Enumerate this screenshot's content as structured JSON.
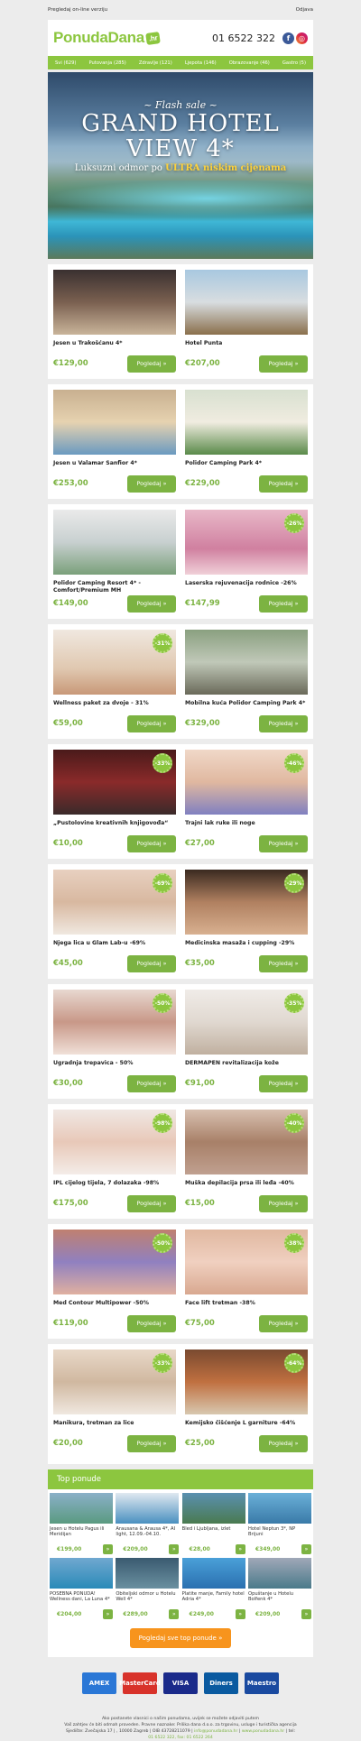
{
  "topbar": {
    "online": "Pregledaj on-line verziju",
    "unsubscribe": "Odjava"
  },
  "header": {
    "logo": "PonudaDana",
    "logo_hr": ".hr",
    "phone": "01 6522 322",
    "fb": "f",
    "ig": "◎"
  },
  "nav": [
    "Svi (629)",
    "Putovanja (285)",
    "Zdravlje (121)",
    "Ljepota (146)",
    "Obrazovanje (46)",
    "Gastro (5)"
  ],
  "hero": {
    "flash": "~ Flash sale ~",
    "title1": "GRAND HOTEL",
    "title2": "VIEW 4*",
    "sub_a": "Luksuzni odmor po ",
    "sub_b": "ULTRA niskim cijenama"
  },
  "cards": [
    {
      "title": "Jesen u Trakošćanu 4*",
      "price": "€129,00",
      "button": "Pogledaj »",
      "bg": "linear-gradient(180deg,#3a3030,#7a6050 50%,#c9b49a)"
    },
    {
      "title": "Hotel Punta",
      "price": "€207,00",
      "button": "Pogledaj »",
      "bg": "linear-gradient(180deg,#a8c8e0,#d8dde0 50%,#8a6f4c)"
    },
    {
      "title": "Jesen u Valamar Sanfior 4*",
      "price": "€253,00",
      "button": "Pogledaj »",
      "bg": "linear-gradient(180deg,#c8b090,#e6d2b0 50%,#6a9ac0)"
    },
    {
      "title": "Polidor Camping Park 4*",
      "price": "€229,00",
      "button": "Pogledaj »",
      "bg": "linear-gradient(180deg,#d8e0d0,#f0ece0 50%,#5a8a4a)"
    },
    {
      "title": "Polidor Camping Resort 4* - Comfort/Premium MH",
      "price": "€149,00",
      "button": "Pogledaj »",
      "bg": "linear-gradient(180deg,#eaeaea,#c8d0d0 50%,#7aa07a)"
    },
    {
      "title": "Laserska rejuvenacija rodnice -26%",
      "price": "€147,99",
      "button": "Pogledaj »",
      "bg": "linear-gradient(180deg,#e8b8c8,#d080a0 60%,#f0d0d8)",
      "badge": "-26%"
    },
    {
      "title": "Wellness paket za dvoje - 31%",
      "price": "€59,00",
      "button": "Pogledaj »",
      "bg": "linear-gradient(180deg,#f0e8e0,#e0c8b0 60%,#c89878)",
      "badge": "-31%"
    },
    {
      "title": "Mobilna kuća Polidor Camping Park 4*",
      "price": "€329,00",
      "button": "Pogledaj »",
      "bg": "linear-gradient(180deg,#8aa080,#c0c8b8 50%,#6a6a5a)"
    },
    {
      "title": "„Pustolovine kreativnih knjigovođa“",
      "price": "€10,00",
      "button": "Pogledaj »",
      "bg": "linear-gradient(180deg,#4a1a1a,#8a2a2a 50%,#3a2a2a)",
      "badge": "-33%"
    },
    {
      "title": "Trajni lak ruke ili noge",
      "price": "€27,00",
      "button": "Pogledaj »",
      "bg": "linear-gradient(180deg,#f0d8c8,#e0b8a0 50%,#8080c0)",
      "badge": "-46%"
    },
    {
      "title": "Njega lica u Glam Lab-u -69%",
      "price": "€45,00",
      "button": "Pogledaj »",
      "bg": "linear-gradient(180deg,#e8d0c0,#d8b8a0 50%,#f0e8e0)",
      "badge": "-69%"
    },
    {
      "title": "Medicinska masaža i cupping -29%",
      "price": "€35,00",
      "button": "Pogledaj »",
      "bg": "linear-gradient(180deg,#3a2a20,#b08060 50%,#d8b090)",
      "badge": "-29%"
    },
    {
      "title": "Ugradnja trepavica - 50%",
      "price": "€30,00",
      "button": "Pogledaj »",
      "bg": "linear-gradient(180deg,#e8d8d0,#c89888 50%,#f0e0d8)",
      "badge": "-50%"
    },
    {
      "title": "DERMAPEN revitalizacija kože",
      "price": "€91,00",
      "button": "Pogledaj »",
      "bg": "linear-gradient(180deg,#f0ece8,#e0d8d0 50%,#c0b0a0)",
      "badge": "-35%"
    },
    {
      "title": "IPL cijelog tijela, 7 dolazaka -98%",
      "price": "€175,00",
      "button": "Pogledaj »",
      "bg": "linear-gradient(180deg,#f0e8e4,#e8c8b8 50%,#f4ece8)",
      "badge": "-98%"
    },
    {
      "title": "Muška depilacija prsa ili leđa -40%",
      "price": "€15,00",
      "button": "Pogledaj »",
      "bg": "linear-gradient(180deg,#d8c0b0,#a88068 50%,#c0a090)",
      "badge": "-40%"
    },
    {
      "title": "Med Contour Multipower -50%",
      "price": "€119,00",
      "button": "Pogledaj »",
      "bg": "linear-gradient(180deg,#c08070,#9080c0 50%,#e0b0a0)",
      "badge": "-50%"
    },
    {
      "title": "Face lift tretman -38%",
      "price": "€75,00",
      "button": "Pogledaj »",
      "bg": "linear-gradient(180deg,#e0b8a0,#f0d0c0 50%,#d8a890)",
      "badge": "-38%"
    },
    {
      "title": "Manikura, tretman za lice",
      "price": "€20,00",
      "button": "Pogledaj »",
      "bg": "linear-gradient(180deg,#e8d8c8,#d0b8a0 50%,#f0e8e0)",
      "badge": "-33%"
    },
    {
      "title": "Kemijsko čišćenje L garniture -64%",
      "price": "€25,00",
      "button": "Pogledaj »",
      "bg": "linear-gradient(180deg,#7a4a30,#c07040 50%,#d8c8b0)",
      "badge": "-64%"
    }
  ],
  "top": {
    "title": "Top ponude",
    "all_button": "Pogledaj sve top ponude »",
    "items": [
      {
        "name": "Jesen u Hotelu Pagus ili Meridijan",
        "price": "€199,00",
        "bg": "linear-gradient(180deg,#8ab0c8,#5a9a80)"
      },
      {
        "name": "Arausana & Arausa 4*, AI light, 12.09.-04.10.",
        "price": "€209,00",
        "bg": "linear-gradient(180deg,#e0e8f0,#4a90c0)"
      },
      {
        "name": "Bled i Ljubljana, izlet",
        "price": "€28,00",
        "bg": "linear-gradient(180deg,#5a90b0,#4a7a50)"
      },
      {
        "name": "Hotel Neptun 3*, NP Brijuni",
        "price": "€349,00",
        "bg": "linear-gradient(180deg,#6ab0d8,#3a7aa8)"
      },
      {
        "name": "POSEBNA PONUDA! Wellness dani, La Luna 4*",
        "price": "€204,00",
        "bg": "linear-gradient(180deg,#70a8d0,#2a8ab8)"
      },
      {
        "name": "Obiteljski odmor u Hotelu Well 4*",
        "price": "€289,00",
        "bg": "linear-gradient(180deg,#3a5a70,#6a90a0)"
      },
      {
        "name": "Platite manje, Family hotel Adria 4*",
        "price": "€249,00",
        "bg": "linear-gradient(180deg,#4aa0d8,#2a70b0)"
      },
      {
        "name": "Opuštanje u Hotelu Bolfenk 4*",
        "price": "€209,00",
        "bg": "linear-gradient(180deg,#a0a8b8,#4a7a8a)"
      }
    ]
  },
  "payments": [
    {
      "name": "AMEX",
      "color": "#2a77d6"
    },
    {
      "name": "MasterCard",
      "color": "#d8322a"
    },
    {
      "name": "VISA",
      "color": "#1a2a8a"
    },
    {
      "name": "Diners",
      "color": "#0a5aa0"
    },
    {
      "name": "Maestro",
      "color": "#1a4aa0"
    }
  ],
  "footer": {
    "line1": "Ako postanete vlasnici o našim ponudama, uvijek se možete odjaviti putem",
    "line2": "Vaš zahtjev će biti odmah proveden. Pravne naznake: Prilika dana d.o.o. za trgovinu, usluge i turistička agencija",
    "line3a": "Sjedište: Zvečajska 17 | , 10000 Zagreb | OIB 43728211079 | ",
    "line3b": "info@ponudadana.hr",
    "line3c": " | ",
    "line3d": "www.ponudadana.hr",
    "line3e": " | tel:",
    "line4": "01 6522 322, fax: 01 6522 264"
  }
}
